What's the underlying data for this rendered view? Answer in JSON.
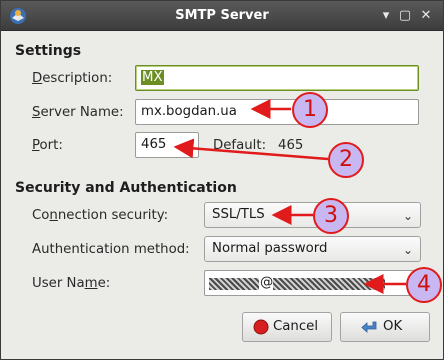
{
  "window": {
    "title": "SMTP Server"
  },
  "settings": {
    "heading": "Settings",
    "description_label_u": "D",
    "description_label_rest": "escription:",
    "description_value": "MX",
    "server_name_label_u": "S",
    "server_name_label_rest": "erver Name:",
    "server_name_value": "mx.bogdan.ua",
    "port_label_u": "P",
    "port_label_rest": "ort:",
    "port_value": "465",
    "default_label": "Default:",
    "default_value": "465"
  },
  "security": {
    "heading": "Security and Authentication",
    "connection_label_pre": "Co",
    "connection_label_u": "n",
    "connection_label_rest": "nection security:",
    "connection_value": "SSL/TLS",
    "auth_label_pre": "Authentication method:",
    "auth_value": "Normal password",
    "user_label_pre": "User Na",
    "user_label_u": "m",
    "user_label_rest": "e:",
    "user_value_visible": "@"
  },
  "buttons": {
    "cancel": "Cancel",
    "ok": "OK"
  },
  "annotations": [
    "1",
    "2",
    "3",
    "4"
  ],
  "colors": {
    "accent_green": "#6b8e23",
    "annotation_red": "#e11b1b",
    "annotation_fill": "#c9b7f2"
  },
  "icons": [
    "thunderbird-icon",
    "minimize-icon",
    "maximize-icon",
    "close-icon",
    "chevron-down-icon",
    "cancel-icon",
    "ok-icon"
  ]
}
